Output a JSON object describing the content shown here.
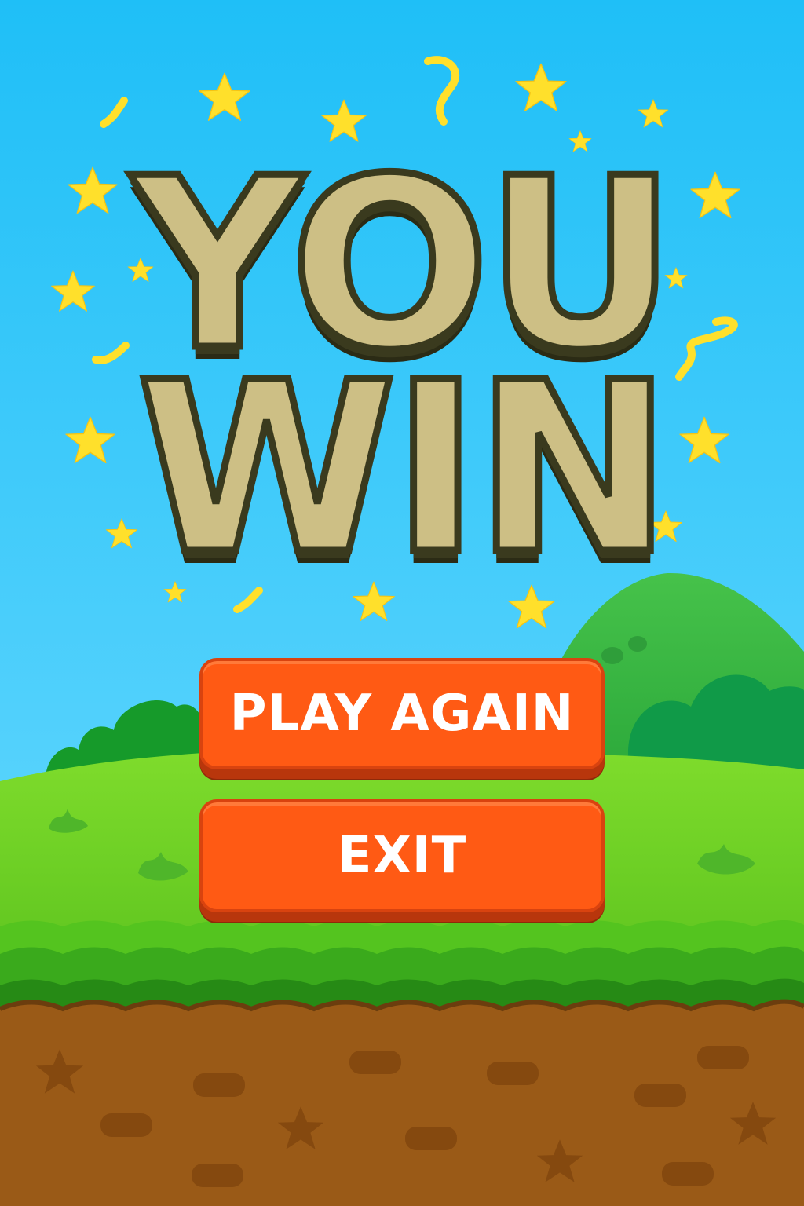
{
  "title": {
    "line1": "YOU",
    "line2": "WIN"
  },
  "buttons": {
    "play_again": "PLAY AGAIN",
    "exit": "EXIT"
  },
  "colors": {
    "sky_top": "#1fbff7",
    "sky_bottom": "#6fdcff",
    "star": "#ffe533",
    "grass": "#6fd12a",
    "hill": "#3bb842",
    "dirt": "#9a5a17",
    "button": "#ff5a14",
    "title_fill": "#cdbf85",
    "title_outline": "#3a3a1e"
  },
  "icons": [
    "star-icon",
    "confetti-icon"
  ]
}
